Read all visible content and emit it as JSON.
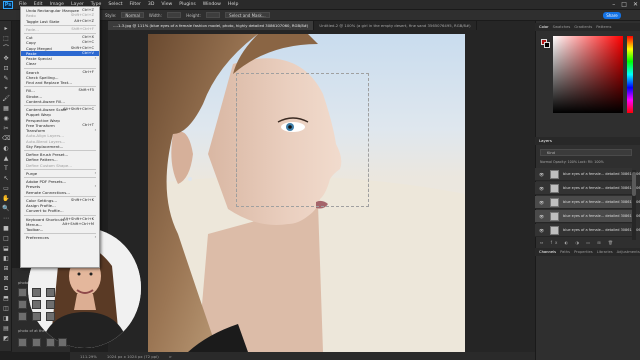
{
  "menubar": {
    "logo": "Ps",
    "items": [
      "File",
      "Edit",
      "Image",
      "Layer",
      "Type",
      "Select",
      "Filter",
      "3D",
      "View",
      "Plugins",
      "Window",
      "Help"
    ],
    "window_controls": [
      "–",
      "□",
      "✕"
    ]
  },
  "optionsbar": {
    "style_label": "Style:",
    "style_value": "Normal",
    "width_label": "Width:",
    "height_label": "Height:",
    "select_mask_label": "Select and Mask...",
    "share_label": "Share"
  },
  "tabs": [
    {
      "label": "...-1-3.jpg @ 111% (blue eyes of a female fashion model, photo, highly detailed 3086107060, RGB/8#)",
      "active": true
    },
    {
      "label": "Untitled-2 @ 100% (a girl in the empty desert, fine sand 3565076495, RGB/8#)",
      "active": false
    }
  ],
  "edit_menu": {
    "items": [
      {
        "label": "Undo Rectangular Marquee",
        "shortcut": "Ctrl+Z"
      },
      {
        "label": "Redo",
        "shortcut": "Shift+Ctrl+Z",
        "disabled": true
      },
      {
        "label": "Toggle Last State",
        "shortcut": "Alt+Ctrl+Z"
      },
      {
        "sep": true
      },
      {
        "label": "Fade...",
        "shortcut": "Shift+Ctrl+F",
        "disabled": true
      },
      {
        "sep": true
      },
      {
        "label": "Cut",
        "shortcut": "Ctrl+X"
      },
      {
        "label": "Copy",
        "shortcut": "Ctrl+C"
      },
      {
        "label": "Copy Merged",
        "shortcut": "Shift+Ctrl+C"
      },
      {
        "label": "Paste",
        "shortcut": "Ctrl+V",
        "highlight": true
      },
      {
        "label": "Paste Special",
        "submenu": true
      },
      {
        "label": "Clear"
      },
      {
        "sep": true
      },
      {
        "label": "Search",
        "shortcut": "Ctrl+F"
      },
      {
        "label": "Check Spelling..."
      },
      {
        "label": "Find and Replace Text..."
      },
      {
        "sep": true
      },
      {
        "label": "Fill...",
        "shortcut": "Shift+F5"
      },
      {
        "label": "Stroke..."
      },
      {
        "label": "Content-Aware Fill..."
      },
      {
        "sep": true
      },
      {
        "label": "Content-Aware Scale",
        "shortcut": "Alt+Shift+Ctrl+C"
      },
      {
        "label": "Puppet Warp"
      },
      {
        "label": "Perspective Warp"
      },
      {
        "label": "Free Transform",
        "shortcut": "Ctrl+T"
      },
      {
        "label": "Transform",
        "submenu": true
      },
      {
        "label": "Auto-Align Layers...",
        "disabled": true
      },
      {
        "label": "Auto-Blend Layers...",
        "disabled": true
      },
      {
        "label": "Sky Replacement..."
      },
      {
        "sep": true
      },
      {
        "label": "Define Brush Preset..."
      },
      {
        "label": "Define Pattern..."
      },
      {
        "label": "Define Custom Shape...",
        "disabled": true
      },
      {
        "sep": true
      },
      {
        "label": "Purge",
        "submenu": true
      },
      {
        "sep": true
      },
      {
        "label": "Adobe PDF Presets..."
      },
      {
        "label": "Presets",
        "submenu": true
      },
      {
        "label": "Remote Connections..."
      },
      {
        "sep": true
      },
      {
        "label": "Color Settings...",
        "shortcut": "Shift+Ctrl+K"
      },
      {
        "label": "Assign Profile..."
      },
      {
        "label": "Convert to Profile..."
      },
      {
        "sep": true
      },
      {
        "label": "Keyboard Shortcuts...",
        "shortcut": "Alt+Shift+Ctrl+K"
      },
      {
        "label": "Menus...",
        "shortcut": "Alt+Shift+Ctrl+M"
      },
      {
        "label": "Toolbar..."
      },
      {
        "sep": true
      },
      {
        "label": "Preferences",
        "submenu": true
      }
    ]
  },
  "left_strip": {
    "label_top": "photo",
    "label_top_right": "of",
    "label_bottom": "photo of at the empty..."
  },
  "status": {
    "zoom": "111.29%",
    "doc_size": "1024 px x 1024 px (72 ppi)",
    "arrow": ">"
  },
  "panels": {
    "color_tabs": [
      "Color",
      "Swatches",
      "Gradients",
      "Patterns"
    ],
    "layers_title": "Layers",
    "layers_tabs_top": [
      "Layers"
    ],
    "layer_search_placeholder": "Kind",
    "layer_options": "Normal  Opacity: 100%  Lock:  Fill: 100%",
    "layers": [
      {
        "name": "blue eyes of a female... detailed 3086107060"
      },
      {
        "name": "blue eyes of a female... detailed 3086107060"
      },
      {
        "name": "blue eyes of a female... detailed 3086107060"
      },
      {
        "name": "blue eyes of a female... detailed 3086107060"
      },
      {
        "name": "blue eyes of a female... detailed 3086107060"
      }
    ],
    "layers_footer": "⇔ fx ◐ ◑ ▭ ⊞ 🗑",
    "bottom_tabs": [
      "Channels",
      "Paths",
      "Properties",
      "Libraries",
      "Adjustments"
    ],
    "accent": "#1473e6",
    "fg_color": "#b01818",
    "bg_color": "#000000"
  }
}
